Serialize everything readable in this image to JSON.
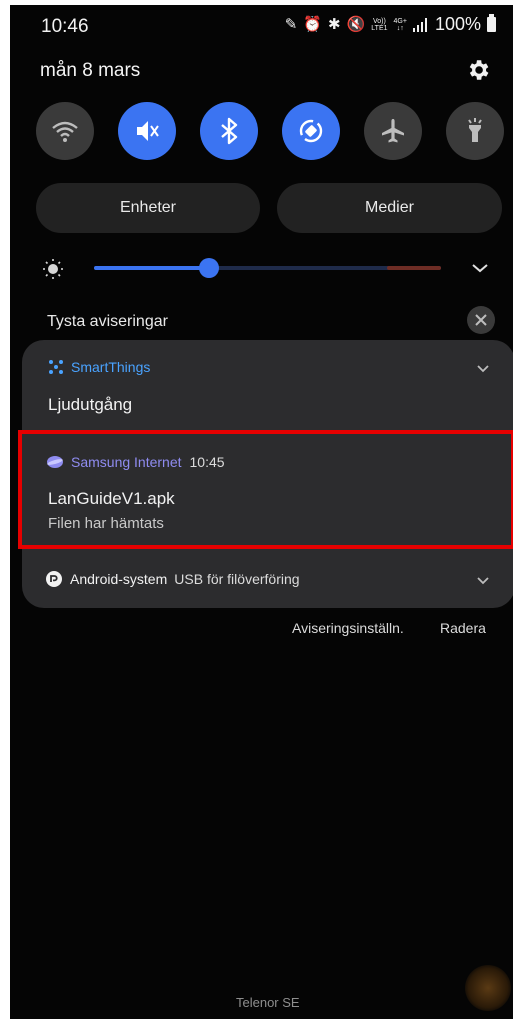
{
  "status_bar": {
    "time": "10:46",
    "volte_top": "Vo))",
    "volte_bottom": "LTE1",
    "net_top": "4G+",
    "net_bottom": "↓↑",
    "battery": "100%"
  },
  "header": {
    "date": "mån 8 mars"
  },
  "quick_toggles": [
    {
      "name": "wifi-toggle",
      "icon": "wifi-icon",
      "state": "off"
    },
    {
      "name": "sound-toggle",
      "icon": "mute-icon",
      "state": "on"
    },
    {
      "name": "bluetooth-toggle",
      "icon": "bluetooth-icon",
      "state": "on"
    },
    {
      "name": "autorotate-toggle",
      "icon": "rotate-icon",
      "state": "on"
    },
    {
      "name": "airplane-toggle",
      "icon": "airplane-icon",
      "state": "off"
    },
    {
      "name": "flashlight-toggle",
      "icon": "flashlight-icon",
      "state": "off"
    }
  ],
  "buttons": {
    "devices": "Enheter",
    "media": "Medier"
  },
  "brightness": {
    "level": 0.33,
    "accent": "#3b74f2"
  },
  "silent_section": {
    "label": "Tysta aviseringar"
  },
  "notifications": [
    {
      "app": "SmartThings",
      "app_color": "#4aa3ff",
      "title": "Ljudutgång"
    },
    {
      "app": "Samsung Internet",
      "app_color": "#8f8cf0",
      "time": "10:45",
      "title": "LanGuideV1.apk",
      "subtitle": "Filen har hämtats"
    },
    {
      "app": "Android-system",
      "app_color": "#f2f2f2",
      "title": "USB för filöverföring"
    }
  ],
  "actions": {
    "settings": "Aviseringsinställn.",
    "clear": "Radera"
  },
  "footer": {
    "carrier": "Telenor SE"
  },
  "colors": {
    "highlight": "#e60000",
    "toggle_on": "#3b74f2",
    "toggle_off": "#3a3a3a"
  }
}
